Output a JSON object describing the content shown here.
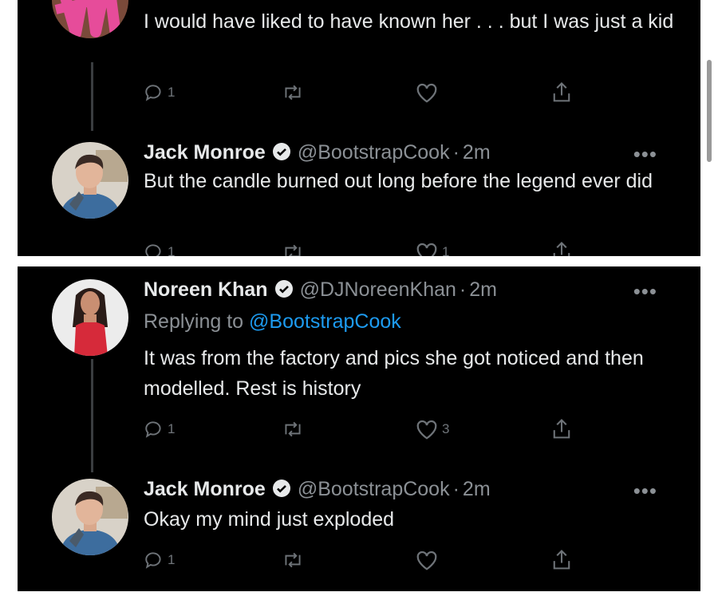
{
  "colors": {
    "background": "#000000",
    "text": "#e7e9ea",
    "muted": "#8b9095",
    "link": "#1d9bf0",
    "verified": "#e7e9ea"
  },
  "top_panel": {
    "tweet_1": {
      "text": "I would have liked to have known her . . . but I was just a kid",
      "actions": {
        "reply_count": "1",
        "retweet_count": "",
        "like_count": ""
      }
    },
    "tweet_2": {
      "name": "Jack Monroe",
      "handle": "@BootstrapCook",
      "separator": "·",
      "time": "2m",
      "more": "•••",
      "text": "But the candle burned out long before the legend ever did",
      "actions": {
        "reply_count": "1",
        "retweet_count": "",
        "like_count": "1"
      }
    }
  },
  "bottom_panel": {
    "tweet_3": {
      "name": "Noreen Khan",
      "handle": "@DJNoreenKhan",
      "separator": "·",
      "time": "2m",
      "more": "•••",
      "replying_prefix": "Replying to",
      "replying_mention": "@BootstrapCook",
      "text": "It was from the factory and pics she got noticed and then modelled. Rest is history",
      "actions": {
        "reply_count": "1",
        "retweet_count": "",
        "like_count": "3"
      }
    },
    "tweet_4": {
      "name": "Jack Monroe",
      "handle": "@BootstrapCook",
      "separator": "·",
      "time": "2m",
      "more": "•••",
      "text": "Okay my mind just exploded",
      "actions": {
        "reply_count": "1",
        "retweet_count": "",
        "like_count": ""
      }
    }
  },
  "icons": [
    "reply-icon",
    "retweet-icon",
    "like-icon",
    "share-icon",
    "verified-badge-icon",
    "more-icon"
  ]
}
